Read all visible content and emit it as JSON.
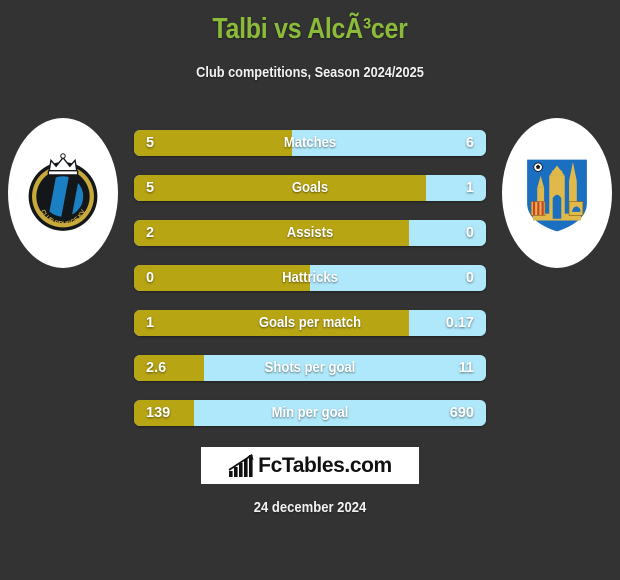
{
  "header": {
    "title": "Talbi vs AlcÃ³cer",
    "subtitle": "Club competitions, Season 2024/2025"
  },
  "badges": {
    "home": {
      "name": "club-brugge-badge",
      "club": "CLUB BRUGGE KV",
      "colors": {
        "blue": "#1B7FC4",
        "black": "#14171A",
        "gold": "#C8A93A"
      }
    },
    "away": {
      "name": "castle-crest-badge",
      "colors": {
        "blue": "#1B6FC0",
        "gold": "#E0B94A"
      }
    }
  },
  "colors": {
    "background": "#333333",
    "title": "#8CBB3A",
    "home_bar": "#B8A513",
    "away_bar": "#AFE8FA",
    "text": "#ffffff"
  },
  "chart_data": {
    "type": "bar",
    "title": "Talbi vs AlcÃ³cer",
    "subtitle": "Club competitions, Season 2024/2025",
    "orientation": "horizontal-diverging",
    "series": [
      {
        "name": "Talbi",
        "side": "home",
        "color": "#B8A513"
      },
      {
        "name": "AlcÃ³cer",
        "side": "away",
        "color": "#AFE8FA"
      }
    ],
    "categories": [
      "Matches",
      "Goals",
      "Assists",
      "Hattricks",
      "Goals per match",
      "Shots per goal",
      "Min per goal"
    ],
    "rows": [
      {
        "label": "Matches",
        "home": "5",
        "away": "6",
        "home_pct": 45
      },
      {
        "label": "Goals",
        "home": "5",
        "away": "1",
        "home_pct": 83
      },
      {
        "label": "Assists",
        "home": "2",
        "away": "0",
        "home_pct": 78
      },
      {
        "label": "Hattricks",
        "home": "0",
        "away": "0",
        "home_pct": 50
      },
      {
        "label": "Goals per match",
        "home": "1",
        "away": "0.17",
        "home_pct": 78
      },
      {
        "label": "Shots per goal",
        "home": "2.6",
        "away": "11",
        "home_pct": 20
      },
      {
        "label": "Min per goal",
        "home": "139",
        "away": "690",
        "home_pct": 17
      }
    ]
  },
  "footer": {
    "logo_text": "FcTables.com",
    "logo_icon": "bar-chart-icon",
    "date": "24 december 2024"
  }
}
